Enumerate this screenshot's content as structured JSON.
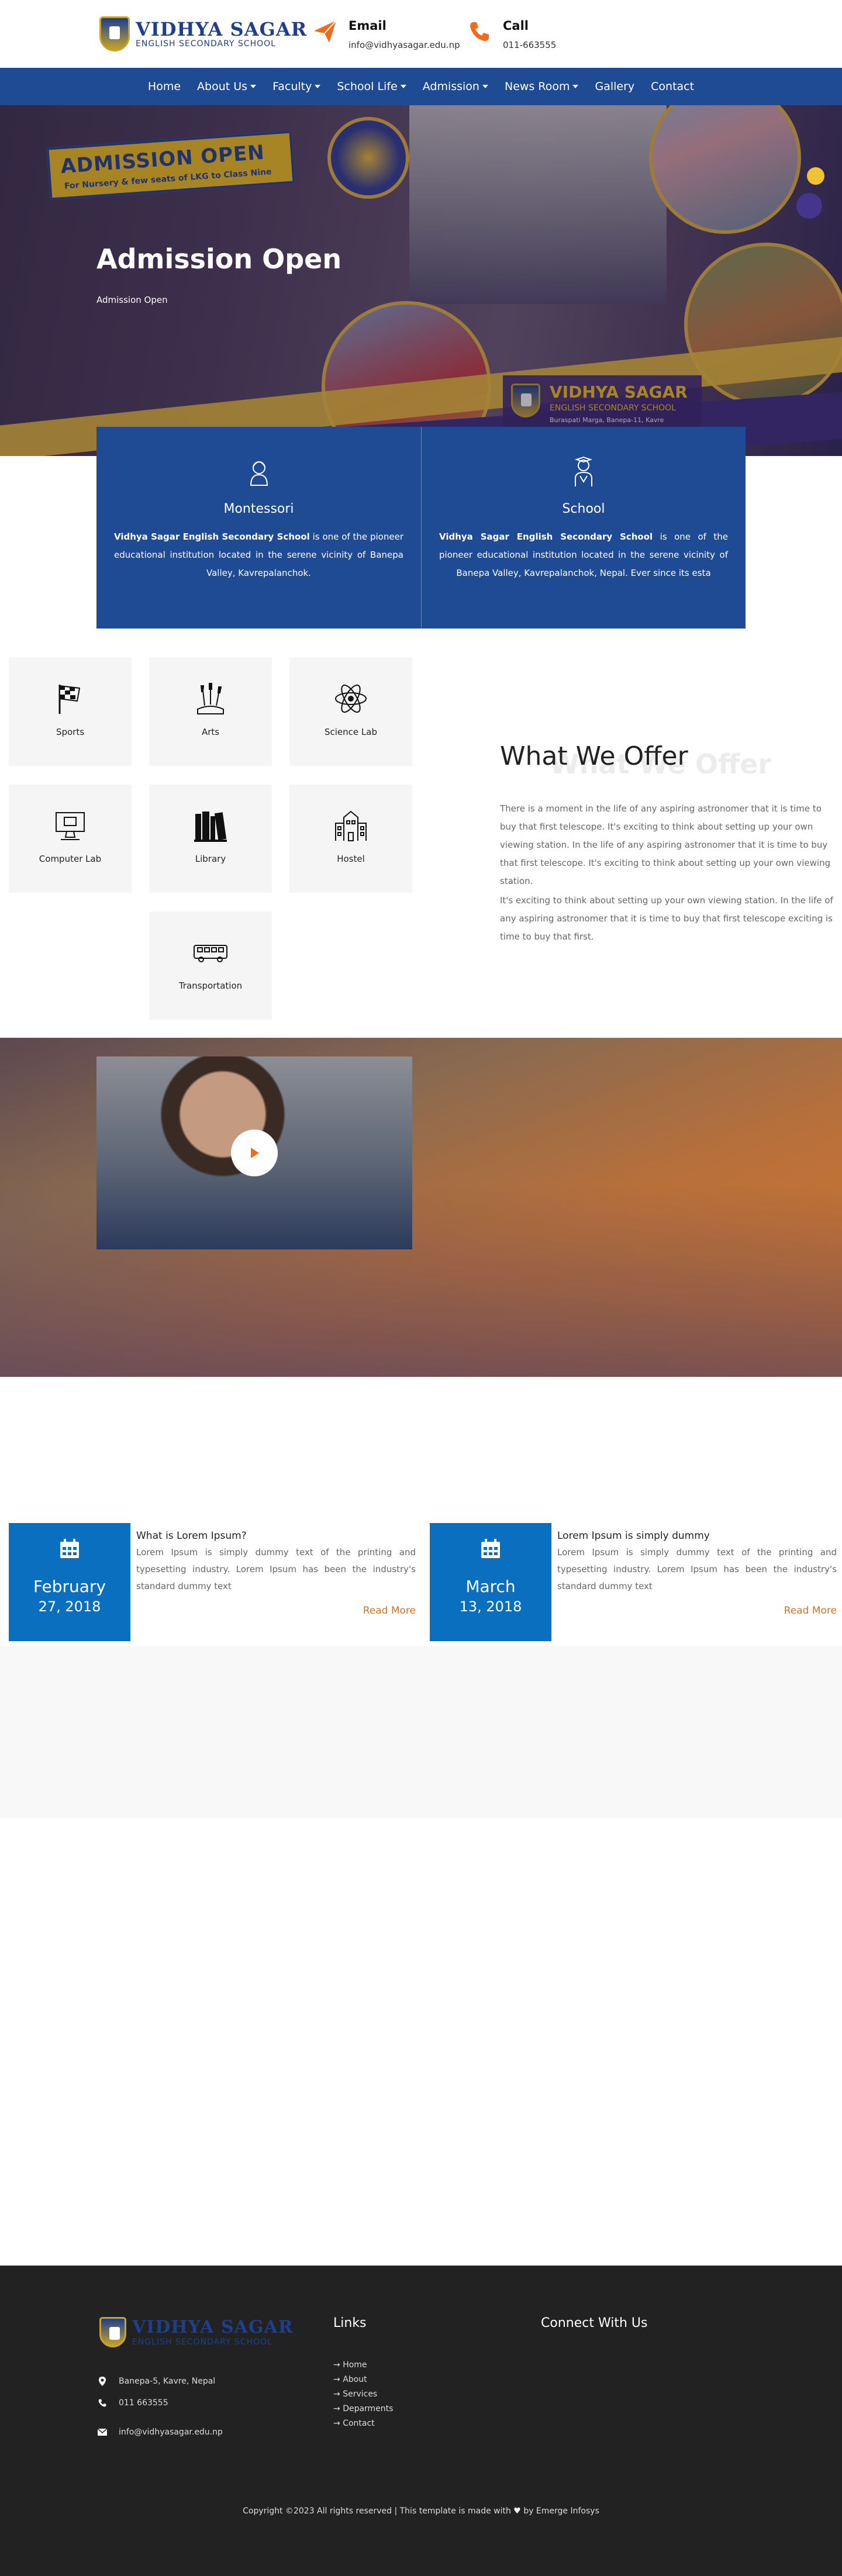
{
  "header": {
    "school_name": "VIDHYA SAGAR",
    "school_sub": "ENGLISH SECONDARY SCHOOL",
    "email_title": "Email",
    "email_value": "info@vidhyasagar.edu.np",
    "call_title": "Call",
    "call_value": "011-663555"
  },
  "nav": {
    "items": [
      {
        "label": "Home"
      },
      {
        "label": "About Us"
      },
      {
        "label": "Faculty"
      },
      {
        "label": "School Life"
      },
      {
        "label": "Admission"
      },
      {
        "label": "News Room"
      },
      {
        "label": "Gallery"
      },
      {
        "label": "Contact"
      }
    ]
  },
  "hero": {
    "banner_title": "ADMISSION OPEN",
    "banner_sub": "For Nursery & few seats of LKG to Class Nine",
    "badge_title": "VIDHYA SAGAR",
    "badge_sub": "ENGLISH SECONDARY SCHOOL",
    "badge_addr": "Buraspati Marga, Banepa-11, Kavre",
    "title": "Admission Open",
    "breadcrumb": "Admission Open"
  },
  "features": [
    {
      "icon": "montessori-icon",
      "title": "Montessori",
      "bold": "Vidhya Sagar English Secondary School",
      "text": " is one of the pioneer educational institution located in the serene vicinity of Banepa Valley, Kavrepalanchok."
    },
    {
      "icon": "school-icon",
      "title": "School",
      "bold": "Vidhya Sagar English Secondary School",
      "text": " is one of the pioneer educational institution located in the serene vicinity of Banepa Valley, Kavrepalanchok, Nepal. Ever since its esta"
    }
  ],
  "offer": {
    "tiles": [
      {
        "label": "Sports",
        "icon": "checkered-flag-icon"
      },
      {
        "label": "Arts",
        "icon": "paint-brushes-icon"
      },
      {
        "label": "Science Lab",
        "icon": "atom-icon"
      },
      {
        "label": "Computer Lab",
        "icon": "computer-icon"
      },
      {
        "label": "Library",
        "icon": "books-icon"
      },
      {
        "label": "Hostel",
        "icon": "building-icon"
      },
      {
        "label": "Transportation",
        "icon": "bus-icon"
      }
    ],
    "ghost": "What We Offer",
    "title": "What We Offer",
    "para1": "There is a moment in the life of any aspiring astronomer that it is time to buy that first telescope. It's exciting to think about setting up your own viewing station. In the life of any aspiring astronomer that it is time to buy that first telescope. It's exciting to think about setting up your own viewing station.",
    "para2": "It's exciting to think about setting up your own viewing station. In the life of any aspiring astronomer that it is time to buy that first telescope exciting is time to buy that first."
  },
  "news": [
    {
      "month": "February",
      "day": "27, 2018",
      "title": "What is Lorem Ipsum?",
      "text": "Lorem Ipsum is simply dummy text of the printing and typesetting industry. Lorem Ipsum has been the industry's standard dummy text",
      "more": "Read More"
    },
    {
      "month": "March",
      "day": "13, 2018",
      "title": "Lorem Ipsum is simply dummy",
      "text": "Lorem Ipsum is simply dummy text of the printing and typesetting industry. Lorem Ipsum has been the industry's standard dummy text",
      "more": "Read More"
    }
  ],
  "footer": {
    "school_name": "VIDHYA SAGAR",
    "school_sub": "ENGLISH SECONDARY SCHOOL",
    "address": "Banepa-5, Kavre, Nepal",
    "phone": "011 663555",
    "email": "info@vidhyasagar.edu.np",
    "links_title": "Links",
    "links": [
      "Home",
      "About",
      "Services",
      "Deparments",
      "Contact"
    ],
    "connect_title": "Connect With Us",
    "copyright_pre": "Copyright ©2023 All rights reserved | This template is made with",
    "copyright_post": "by Emerge Infosys"
  },
  "colors": {
    "brand_blue": "#1e4b93",
    "accent_orange": "#e0701a",
    "date_blue": "#0a6fbf",
    "footer_bg": "#222222"
  }
}
